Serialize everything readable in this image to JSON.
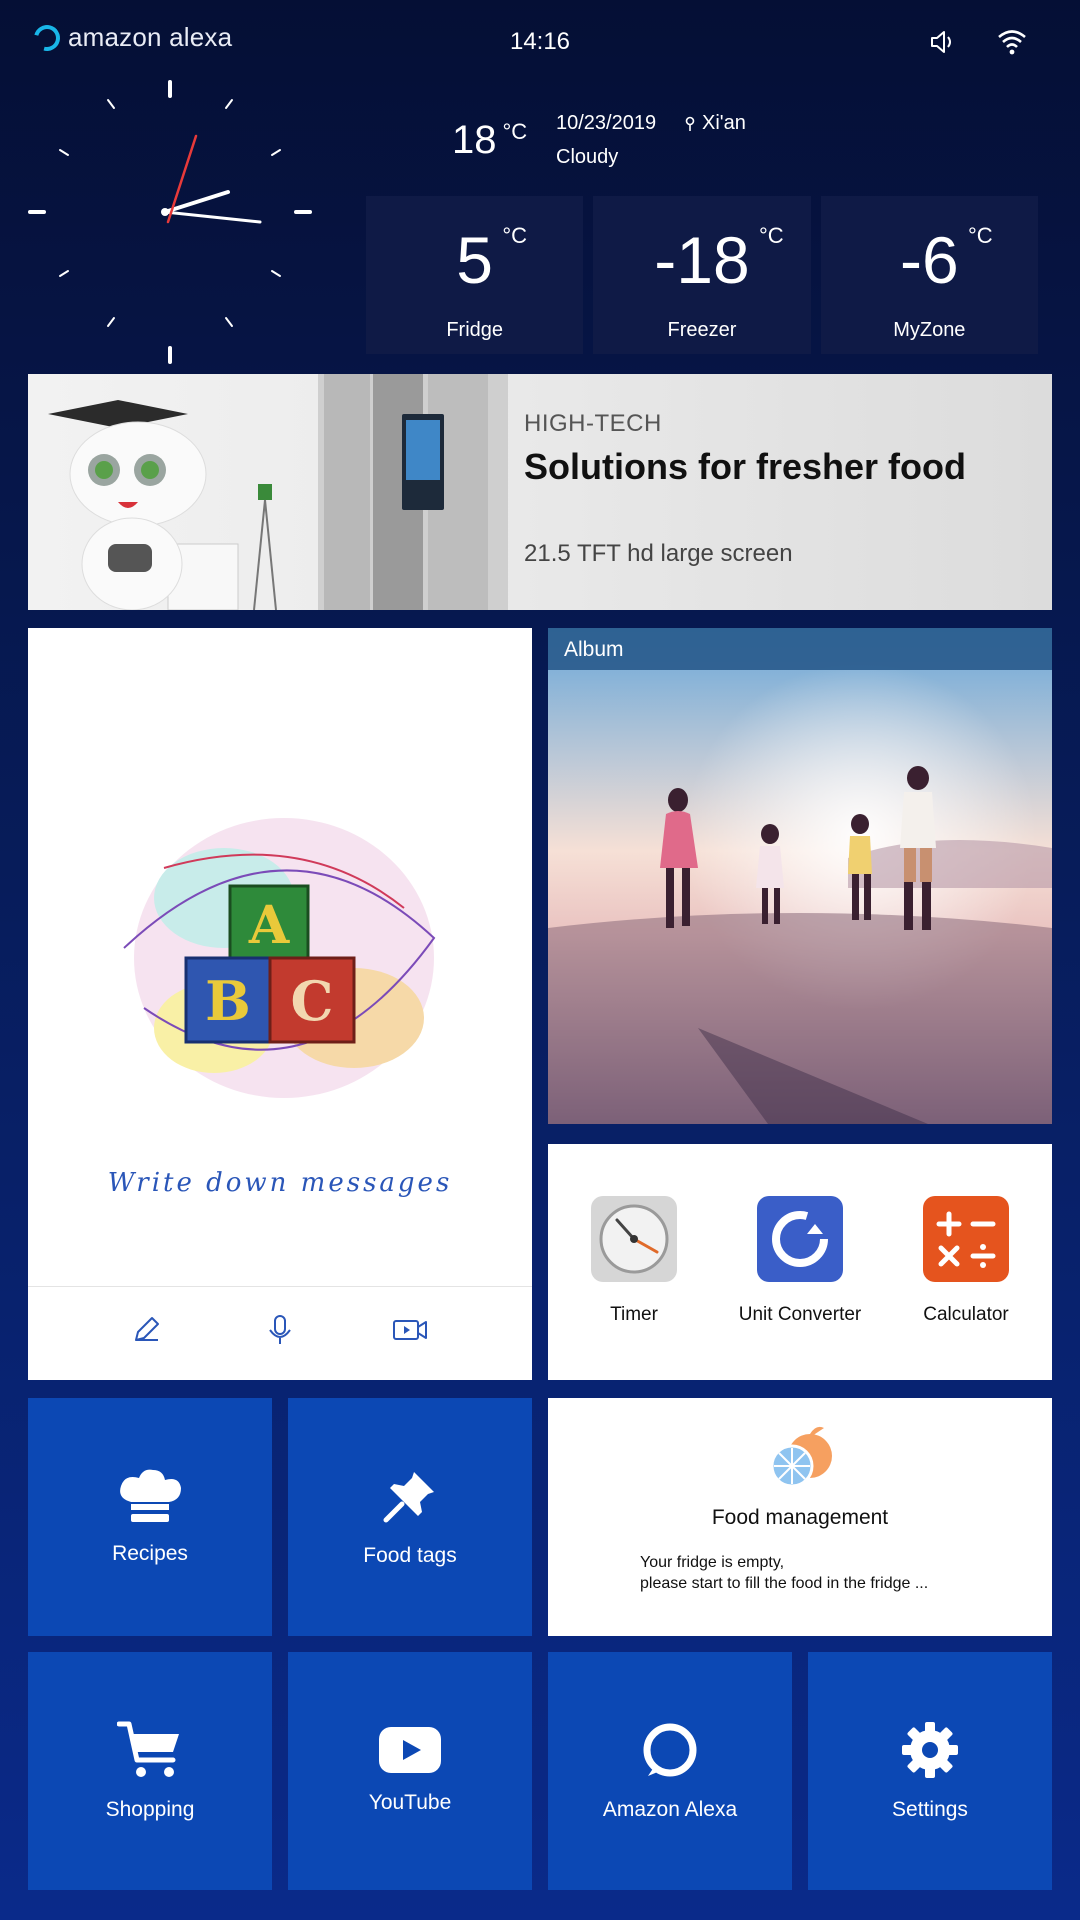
{
  "status_bar": {
    "brand": "amazon alexa",
    "time": "14:16",
    "icons": [
      "volume-icon",
      "wifi-icon"
    ]
  },
  "weather": {
    "temperature": "18",
    "unit": "°C",
    "date": "10/23/2019",
    "location": "Xi'an",
    "condition": "Cloudy"
  },
  "compartments": [
    {
      "value": "5",
      "unit": "°C",
      "label": "Fridge"
    },
    {
      "value": "-18",
      "unit": "°C",
      "label": "Freezer"
    },
    {
      "value": "-6",
      "unit": "°C",
      "label": "MyZone"
    }
  ],
  "banner": {
    "subtitle": "HIGH-TECH",
    "title": "Solutions for fresher food",
    "description": "21.5 TFT hd large screen"
  },
  "message_card": {
    "text": "Write down messages",
    "block_letters": [
      "A",
      "B",
      "C"
    ],
    "tools": [
      "pencil-icon",
      "microphone-icon",
      "video-icon"
    ]
  },
  "album": {
    "title": "Album"
  },
  "utilities": [
    {
      "label": "Timer",
      "icon": "timer-icon"
    },
    {
      "label": "Unit Converter",
      "icon": "unit-converter-icon"
    },
    {
      "label": "Calculator",
      "icon": "calculator-icon"
    }
  ],
  "tiles": {
    "recipes": "Recipes",
    "food_tags": "Food tags",
    "shopping": "Shopping",
    "youtube": "YouTube",
    "alexa": "Amazon Alexa",
    "settings": "Settings"
  },
  "food_management": {
    "title": "Food management",
    "line1": "Your fridge is empty,",
    "line2": "please start to fill the food in the fridge ..."
  },
  "colors": {
    "background_top": "#050f35",
    "background_bottom": "#0a2a8a",
    "tile_blue": "#0c48b4",
    "alexa_cyan": "#19b6e8",
    "message_blue": "#2a56b8"
  }
}
